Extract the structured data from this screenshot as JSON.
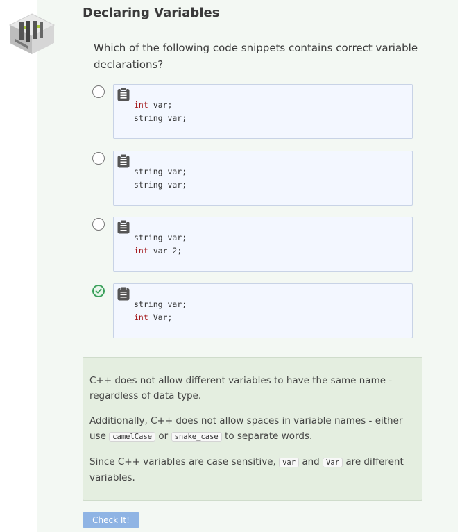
{
  "header": {
    "title": "Declaring Variables"
  },
  "question": {
    "text": "Which of the following code snippets contains correct variable declarations?"
  },
  "options": [
    {
      "selected": false,
      "lines": [
        {
          "kw": "int",
          "rest": " var;"
        },
        {
          "kw": "",
          "rest": "string var;"
        }
      ]
    },
    {
      "selected": false,
      "lines": [
        {
          "kw": "",
          "rest": "string var;"
        },
        {
          "kw": "",
          "rest": "string var;"
        }
      ]
    },
    {
      "selected": false,
      "lines": [
        {
          "kw": "",
          "rest": "string var;"
        },
        {
          "kw": "int",
          "rest": " var 2;"
        }
      ]
    },
    {
      "selected": true,
      "lines": [
        {
          "kw": "",
          "rest": "string var;"
        },
        {
          "kw": "int",
          "rest": " Var;"
        }
      ]
    }
  ],
  "feedback": {
    "p1": "C++ does not allow different variables to have the same name - regardless of data type.",
    "p2_before": "Additionally, C++ does not allow spaces in variable names - either use",
    "p2_code1": "camelCase",
    "p2_mid": "or",
    "p2_code2": "snake_case",
    "p2_after": "to separate words.",
    "p3_before": "Since C++ variables are case sensitive,",
    "p3_code1": "var",
    "p3_mid": "and",
    "p3_code2": "Var",
    "p3_after": "are different variables."
  },
  "actions": {
    "check_label": "Check It!"
  },
  "colors": {
    "keyword": "#a3181b",
    "selected_radio": "#3aa05a",
    "button": "#8fb4e4"
  },
  "icons": {
    "logo": "codio-logo-icon",
    "clipboard": "clipboard-icon",
    "check": "check-circle-icon"
  }
}
